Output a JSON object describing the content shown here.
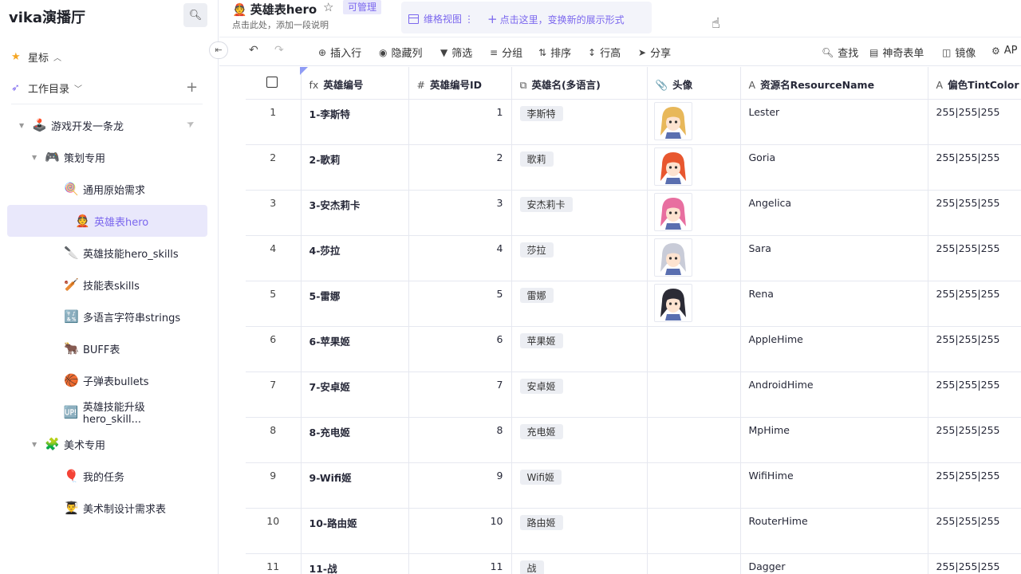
{
  "sidebar": {
    "workspace_title": "vika演播厅",
    "starred_label": "星标",
    "catalog_label": "工作目录",
    "tree": [
      {
        "emoji": "🕹️",
        "label": "游戏开发一条龙",
        "level": 0,
        "folder": true
      },
      {
        "emoji": "🎮",
        "label": "策划专用",
        "level": 1,
        "folder": true
      },
      {
        "emoji": "🍭",
        "label": "通用原始需求",
        "level": 2
      },
      {
        "emoji": "👲",
        "label": "英雄表hero",
        "level": 2,
        "active": true
      },
      {
        "emoji": "🔪",
        "label": "英雄技能hero_skills",
        "level": 2
      },
      {
        "emoji": "🏏",
        "label": "技能表skills",
        "level": 2
      },
      {
        "emoji": "🔣",
        "label": "多语言字符串strings",
        "level": 2
      },
      {
        "emoji": "🐂",
        "label": "BUFF表",
        "level": 2
      },
      {
        "emoji": "🏀",
        "label": "子弹表bullets",
        "level": 2
      },
      {
        "emoji": "🆙",
        "label": "英雄技能升级hero_skill...",
        "level": 2
      },
      {
        "emoji": "🧩",
        "label": "美术专用",
        "level": 1,
        "folder": true
      },
      {
        "emoji": "🎈",
        "label": "我的任务",
        "level": 2
      },
      {
        "emoji": "👨‍🎓",
        "label": "美术制设计需求表",
        "level": 2
      }
    ]
  },
  "header": {
    "emoji": "👲",
    "title": "英雄表hero",
    "permission_badge": "可管理",
    "description": "点击此处，添加一段说明",
    "view_tab_label": "维格视图",
    "add_view_label": "点击这里，变换新的展示形式"
  },
  "toolbar": {
    "insert_row": "插入行",
    "hide_columns": "隐藏列",
    "filter": "筛选",
    "group": "分组",
    "sort": "排序",
    "row_height": "行高",
    "share": "分享",
    "find": "查找",
    "magic_form": "神奇表单",
    "mirror": "镜像",
    "api": "AP"
  },
  "columns": [
    {
      "icon": "fx",
      "label": "英雄编号"
    },
    {
      "icon": "#",
      "label": "英雄编号ID"
    },
    {
      "icon": "⧉",
      "label": "英雄名(多语言)"
    },
    {
      "icon": "📎",
      "label": "头像"
    },
    {
      "icon": "A",
      "label": "资源名ResourceName"
    },
    {
      "icon": "A",
      "label": "偏色TintColor"
    }
  ],
  "rows": [
    {
      "n": "1",
      "code": "1-李斯特",
      "id": "1",
      "name": "李斯特",
      "avatar_hair": "#e8b85a",
      "res": "Lester",
      "tint": "255|255|255"
    },
    {
      "n": "2",
      "code": "2-歌莉",
      "id": "2",
      "name": "歌莉",
      "avatar_hair": "#e8572f",
      "res": "Goria",
      "tint": "255|255|255"
    },
    {
      "n": "3",
      "code": "3-安杰莉卡",
      "id": "3",
      "name": "安杰莉卡",
      "avatar_hair": "#e86fa0",
      "res": "Angelica",
      "tint": "255|255|255"
    },
    {
      "n": "4",
      "code": "4-莎拉",
      "id": "4",
      "name": "莎拉",
      "avatar_hair": "#c9ccd8",
      "res": "Sara",
      "tint": "255|255|255"
    },
    {
      "n": "5",
      "code": "5-雷娜",
      "id": "5",
      "name": "雷娜",
      "avatar_hair": "#2b2b35",
      "res": "Rena",
      "tint": "255|255|255"
    },
    {
      "n": "6",
      "code": "6-苹果姬",
      "id": "6",
      "name": "苹果姬",
      "avatar_hair": "",
      "res": "AppleHime",
      "tint": "255|255|255"
    },
    {
      "n": "7",
      "code": "7-安卓姬",
      "id": "7",
      "name": "安卓姬",
      "avatar_hair": "",
      "res": "AndroidHime",
      "tint": "255|255|255"
    },
    {
      "n": "8",
      "code": "8-充电姬",
      "id": "8",
      "name": "充电姬",
      "avatar_hair": "",
      "res": "MpHime",
      "tint": "255|255|255"
    },
    {
      "n": "9",
      "code": "9-Wifi姬",
      "id": "9",
      "name": "Wifi姬",
      "avatar_hair": "",
      "res": "WifiHime",
      "tint": "255|255|255"
    },
    {
      "n": "10",
      "code": "10-路由姬",
      "id": "10",
      "name": "路由姬",
      "avatar_hair": "",
      "res": "RouterHime",
      "tint": "255|255|255"
    },
    {
      "n": "11",
      "code": "11-战",
      "id": "11",
      "name": "战",
      "avatar_hair": "",
      "res": "Dagger",
      "tint": "255|255|255"
    }
  ]
}
